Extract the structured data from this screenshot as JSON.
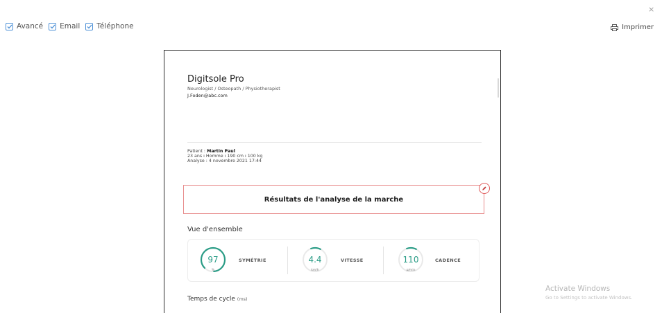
{
  "header": {
    "close_glyph": "×",
    "options": [
      {
        "label": "Avancé",
        "checked": true
      },
      {
        "label": "Email",
        "checked": true
      },
      {
        "label": "Téléphone",
        "checked": true
      }
    ],
    "print_label": "Imprimer"
  },
  "practitioner": {
    "name": "Digitsole Pro",
    "specialty": "Neurologist / Osteopath / Physiotherapist",
    "email": "J.Foden@abc.com"
  },
  "patient": {
    "prefix": "Patient : ",
    "name": "Martin Paul",
    "details": "23 ans  ı  Homme  ı  190 cm  ı  100 kg",
    "analysis": "Analyse : 4 novembre 2021 17:44"
  },
  "results": {
    "title": "Résultats de l'analyse de la marche"
  },
  "overview": {
    "label": "Vue d'ensemble",
    "metrics": [
      {
        "value": "97",
        "unit": "%",
        "label": "SYMÉTRIE"
      },
      {
        "value": "4.4",
        "unit": "km/h",
        "label": "VITESSE"
      },
      {
        "value": "110",
        "unit": "p/min",
        "label": "CADENCE"
      }
    ]
  },
  "cycle": {
    "label": "Temps de cycle",
    "unit": "(ms)"
  },
  "watermark": {
    "title": "Activate Windows",
    "subtitle": "Go to Settings to activate Windows."
  },
  "colors": {
    "accent": "#2a9c86",
    "alert": "#e05c5c",
    "checkbox": "#4b8fd6"
  },
  "icons": [
    "check-icon",
    "printer-icon",
    "pencil-icon",
    "close-icon"
  ]
}
